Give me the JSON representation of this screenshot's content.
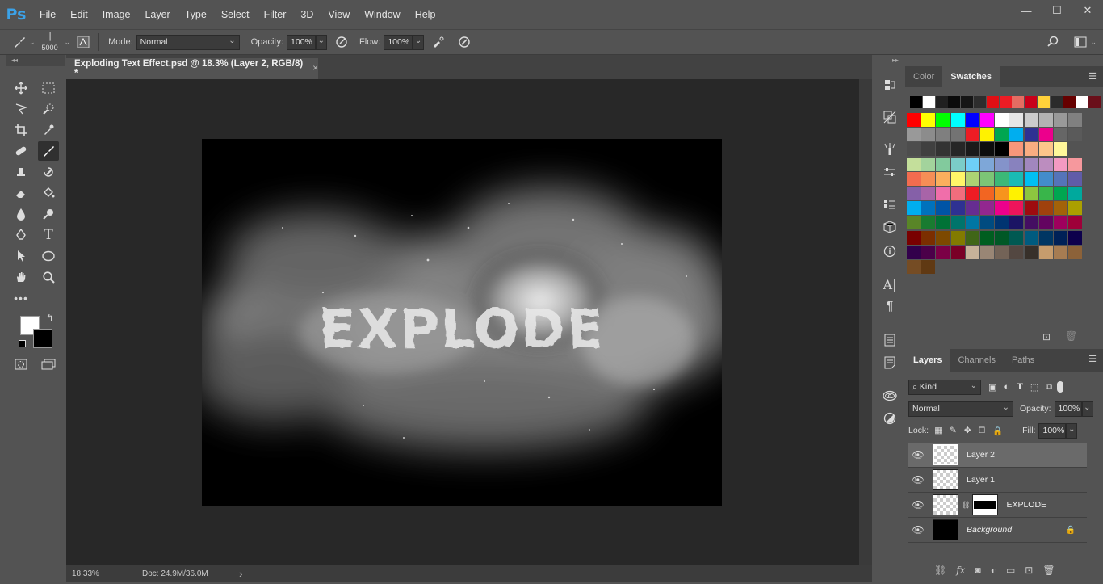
{
  "app": {
    "logo": "Ps"
  },
  "menu": [
    "File",
    "Edit",
    "Image",
    "Layer",
    "Type",
    "Select",
    "Filter",
    "3D",
    "View",
    "Window",
    "Help"
  ],
  "window_controls": {
    "minimize": "—",
    "maximize": "☐",
    "close": "✕"
  },
  "options_bar": {
    "brush_size": "5000",
    "mode_label": "Mode:",
    "mode_value": "Normal",
    "opacity_label": "Opacity:",
    "opacity_value": "100%",
    "flow_label": "Flow:",
    "flow_value": "100%"
  },
  "document": {
    "tab_title": "Exploding Text Effect.psd @ 18.3% (Layer 2, RGB/8) *",
    "close_glyph": "×",
    "artwork_text": "EXPLODE"
  },
  "status": {
    "zoom": "18.33%",
    "doc": "Doc: 24.9M/36.0M",
    "arrow": "›"
  },
  "swatches_panel": {
    "tabs": [
      "Color",
      "Swatches"
    ],
    "active_tab": "Swatches"
  },
  "swatch_rows": [
    [
      "#000000",
      "#ffffff",
      "#202020",
      "#0b0b0b",
      "#161616",
      "#2d2d2d",
      "#e10f14",
      "#ed1c24",
      "#e56c62",
      "#c8001a",
      "#ffd13a",
      "#2b2b2b",
      "#660000",
      "#ffffff",
      "#6a0f1a"
    ],
    [
      "#ff0000",
      "#ffff00",
      "#00ff00",
      "#00ffff",
      "#0000ff",
      "#ff00ff",
      "#ffffff",
      "#e6e6e6",
      "#cccccc",
      "#b3b3b3",
      "#999999",
      "#808080"
    ],
    [
      "#999999",
      "#8c8c8c",
      "#7f7f7f",
      "#737373",
      "#ed1c24",
      "#fff200",
      "#00a651",
      "#00aeef",
      "#2e3192",
      "#ec008c",
      "#666666",
      "#5a5a5a"
    ],
    [
      "#4d4d4d",
      "#404040",
      "#333333",
      "#262626",
      "#1a1a1a",
      "#0d0d0d",
      "#000000",
      "#f7977a",
      "#f9ad81",
      "#fdc68a",
      "#fff79a"
    ],
    [
      "#c4df9b",
      "#a3d39c",
      "#82ca9d",
      "#7bcdc8",
      "#6ecff6",
      "#7ea7d8",
      "#8493ca",
      "#8882be",
      "#a187be",
      "#bc8dbf",
      "#f49ac2",
      "#f6989d"
    ],
    [
      "#f26c4f",
      "#f68e56",
      "#fbaf5d",
      "#fff568",
      "#acd373",
      "#7cc576",
      "#3bb878",
      "#1abbb4",
      "#00bff3",
      "#438ccb",
      "#5574b9",
      "#605ca8"
    ],
    [
      "#8560a8",
      "#a864a8",
      "#f06eaa",
      "#f26d7d",
      "#ed1c24",
      "#f26522",
      "#f7941d",
      "#fff200",
      "#8dc63f",
      "#39b54a",
      "#00a651",
      "#00a99d"
    ],
    [
      "#00aeef",
      "#0072bc",
      "#0054a6",
      "#2e3192",
      "#662d91",
      "#92278f",
      "#ec008c",
      "#ed145b",
      "#9e0b0f",
      "#a0410d",
      "#a36209",
      "#aba000"
    ],
    [
      "#598527",
      "#197b30",
      "#007236",
      "#00746b",
      "#0076a3",
      "#004b80",
      "#003471",
      "#1b1464",
      "#440e62",
      "#630460",
      "#9e005d",
      "#9e0039"
    ],
    [
      "#790000",
      "#7b2e00",
      "#7d4900",
      "#827b00",
      "#406618",
      "#005e20",
      "#005826",
      "#005952",
      "#005b7f",
      "#003663",
      "#002157",
      "#0d004c"
    ],
    [
      "#32004b",
      "#4b0049",
      "#7b0046",
      "#7a0026",
      "#c7b299",
      "#998675",
      "#736357",
      "#534741",
      "#37302a",
      "#c69c6d",
      "#a67c52",
      "#8c6239"
    ],
    [
      "#754c24",
      "#603913"
    ]
  ],
  "layers_panel": {
    "tabs": [
      "Layers",
      "Channels",
      "Paths"
    ],
    "active_tab": "Layers",
    "filter_kind": "Kind",
    "blend_mode": "Normal",
    "opacity_label": "Opacity:",
    "opacity_value": "100%",
    "lock_label": "Lock:",
    "fill_label": "Fill:",
    "fill_value": "100%",
    "layers": [
      {
        "name": "Layer 2",
        "selected": true
      },
      {
        "name": "Layer 1",
        "selected": false
      },
      {
        "name": "EXPLODE",
        "selected": false
      },
      {
        "name": "Background",
        "selected": false
      }
    ]
  }
}
